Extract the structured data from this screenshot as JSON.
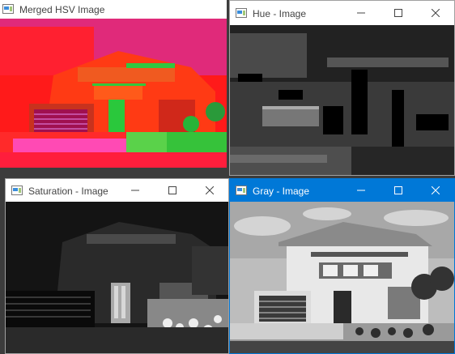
{
  "windows": {
    "merged": {
      "title": "Merged HSV Image",
      "icon": "app-icon"
    },
    "hue": {
      "title": "Hue - Image",
      "icon": "app-icon"
    },
    "saturation": {
      "title": "Saturation - Image",
      "icon": "app-icon"
    },
    "gray": {
      "title": "Gray - Image",
      "icon": "app-icon",
      "active": true
    }
  },
  "controls": [
    "minimize-icon",
    "maximize-icon",
    "close-icon"
  ],
  "colors": {
    "desktop": "#3c3c3c",
    "active_titlebar": "#0078d7",
    "inactive_titlebar": "#ffffff",
    "hsv_red": "#ff1a1a",
    "hsv_magenta": "#b43cc8",
    "hsv_green": "#32d23c"
  }
}
